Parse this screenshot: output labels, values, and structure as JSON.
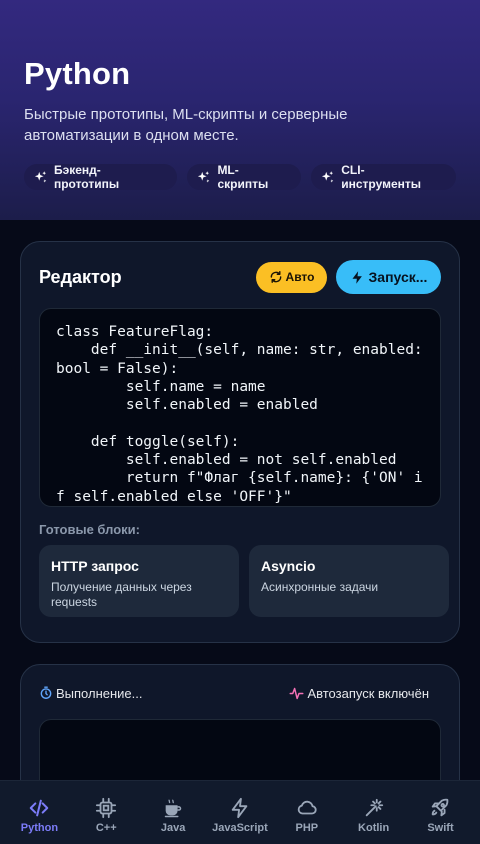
{
  "header": {
    "title": "Python",
    "subtitle": "Быстрые прототипы, ML-скрипты и серверные автоматизации в одном месте.",
    "chips": [
      {
        "label": "Бэкенд-прототипы",
        "icon": "sparkles-icon"
      },
      {
        "label": "ML-скрипты",
        "icon": "sparkles-icon"
      },
      {
        "label": "CLI-инструменты",
        "icon": "sparkles-icon"
      }
    ]
  },
  "editor": {
    "title": "Редактор",
    "auto_label": "Авто",
    "run_label": "Запуск...",
    "code": "class FeatureFlag:\n    def __init__(self, name: str, enabled: bool = False):\n        self.name = name\n        self.enabled = enabled\n\n    def toggle(self):\n        self.enabled = not self.enabled\n        return f\"Флаг {self.name}: {'ON' if self.enabled else 'OFF'}\"",
    "blocks_label": "Готовые блоки:",
    "blocks": [
      {
        "title": "HTTP запрос",
        "desc": "Получение данных через requests"
      },
      {
        "title": "Asyncio",
        "desc": "Асинхронные задачи"
      }
    ]
  },
  "execution": {
    "status": "Выполнение...",
    "autorun": "Автозапуск включён"
  },
  "nav": {
    "items": [
      {
        "label": "Python",
        "icon": "code-icon",
        "active": true
      },
      {
        "label": "C++",
        "icon": "chip-icon",
        "active": false
      },
      {
        "label": "Java",
        "icon": "coffee-icon",
        "active": false
      },
      {
        "label": "JavaScript",
        "icon": "bolt-icon",
        "active": false
      },
      {
        "label": "PHP",
        "icon": "cloud-icon",
        "active": false
      },
      {
        "label": "Kotlin",
        "icon": "magic-wand-icon",
        "active": false
      },
      {
        "label": "Swift",
        "icon": "rocket-icon",
        "active": false
      }
    ]
  },
  "colors": {
    "accent": "#7c7cf8",
    "auto_button": "#fbbf24",
    "run_button": "#38bdf8",
    "header_gradient_top": "#33297f",
    "background": "#060a18"
  }
}
